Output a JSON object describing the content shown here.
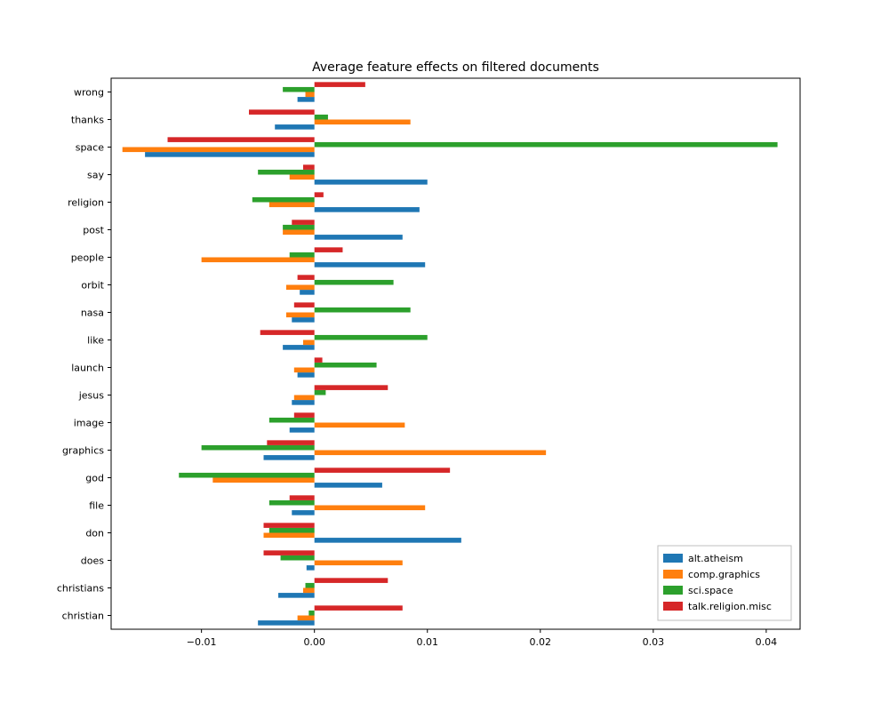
{
  "chart_data": {
    "type": "bar",
    "title": "Average feature effects on filtered documents",
    "xlabel": "",
    "ylabel": "",
    "xlim": [
      -0.018,
      0.043
    ],
    "xticks": [
      -0.01,
      0.0,
      0.01,
      0.02,
      0.03,
      0.04
    ],
    "xticklabels": [
      "−0.01",
      "0.00",
      "0.01",
      "0.02",
      "0.03",
      "0.04"
    ],
    "categories": [
      "christian",
      "christians",
      "does",
      "don",
      "file",
      "god",
      "graphics",
      "image",
      "jesus",
      "launch",
      "like",
      "nasa",
      "orbit",
      "people",
      "post",
      "religion",
      "say",
      "space",
      "thanks",
      "wrong"
    ],
    "series": [
      {
        "name": "alt.atheism",
        "color": "#1f77b4",
        "values": [
          -0.005,
          -0.0032,
          -0.0007,
          0.013,
          -0.002,
          0.006,
          -0.0045,
          -0.0022,
          -0.002,
          -0.0015,
          -0.0028,
          -0.002,
          -0.0013,
          0.0098,
          0.0078,
          0.0093,
          0.01,
          -0.015,
          -0.0035,
          -0.0015
        ]
      },
      {
        "name": "comp.graphics",
        "color": "#ff7f0e",
        "values": [
          -0.0015,
          -0.001,
          0.0078,
          -0.0045,
          0.0098,
          -0.009,
          0.0205,
          0.008,
          -0.0018,
          -0.0018,
          -0.001,
          -0.0025,
          -0.0025,
          -0.01,
          -0.0028,
          -0.004,
          -0.0022,
          -0.017,
          0.0085,
          -0.0008
        ]
      },
      {
        "name": "sci.space",
        "color": "#2ca02c",
        "values": [
          -0.0005,
          -0.0008,
          -0.003,
          -0.004,
          -0.004,
          -0.012,
          -0.01,
          -0.004,
          0.001,
          0.0055,
          0.01,
          0.0085,
          0.007,
          -0.0022,
          -0.0028,
          -0.0055,
          -0.005,
          0.041,
          0.0012,
          -0.0028
        ]
      },
      {
        "name": "talk.religion.misc",
        "color": "#d62728",
        "values": [
          0.0078,
          0.0065,
          -0.0045,
          -0.0045,
          -0.0022,
          0.012,
          -0.0042,
          -0.0018,
          0.0065,
          0.0007,
          -0.0048,
          -0.0018,
          -0.0015,
          0.0025,
          -0.002,
          0.0008,
          -0.001,
          -0.013,
          -0.0058,
          0.0045
        ]
      }
    ],
    "legend": {
      "entries": [
        "alt.atheism",
        "comp.graphics",
        "sci.space",
        "talk.religion.misc"
      ],
      "position": "lower right"
    }
  }
}
